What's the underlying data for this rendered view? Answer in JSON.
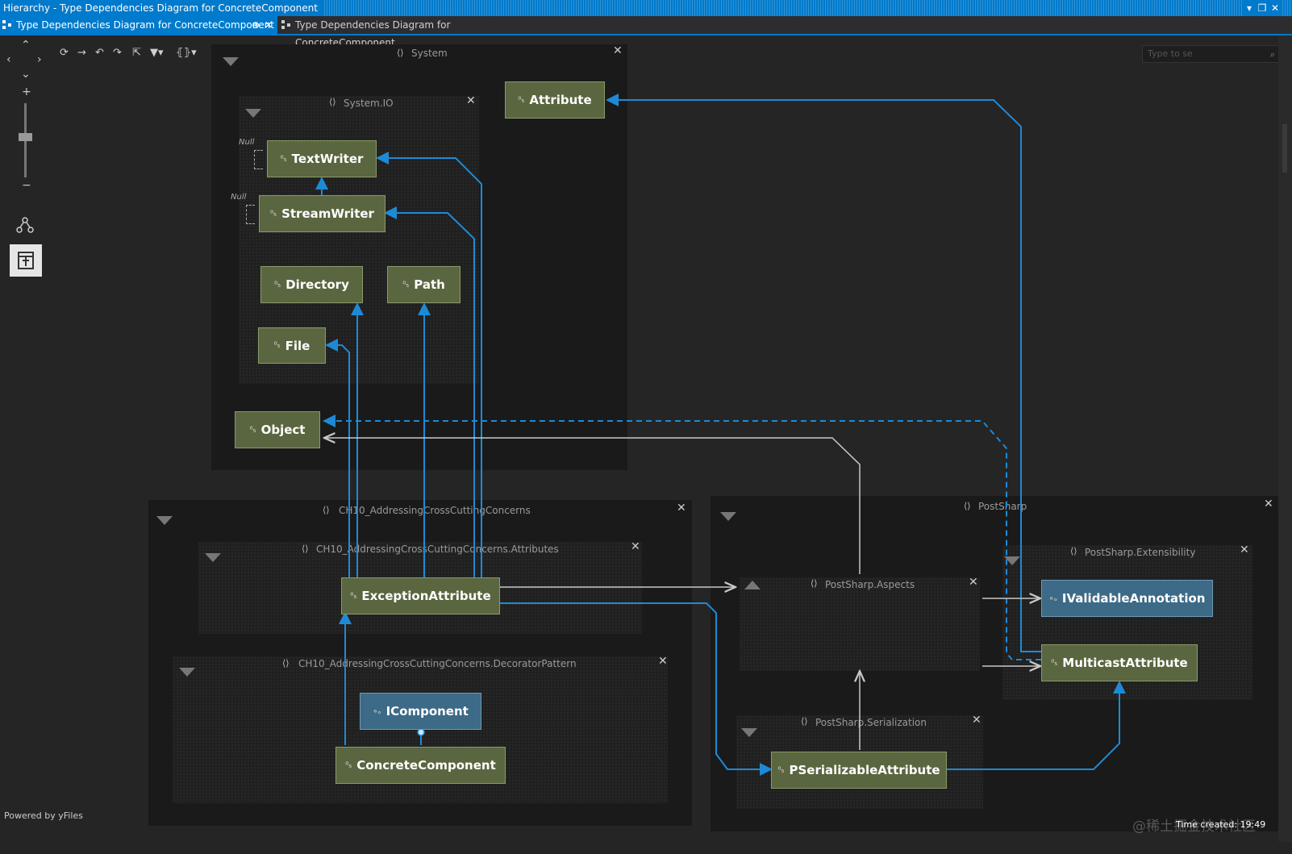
{
  "window": {
    "title": "Hierarchy - Type Dependencies Diagram for ConcreteComponent"
  },
  "tabs": [
    {
      "label": "Type Dependencies Diagram for ConcreteComponent",
      "pin": "⊕",
      "close": "✕"
    },
    {
      "label": "Type Dependencies Diagram for ConcreteComponent"
    }
  ],
  "search": {
    "placeholder": "Type to se"
  },
  "groups": {
    "system": {
      "label": "System"
    },
    "system_io": {
      "label": "System.IO"
    },
    "ch10": {
      "label": "CH10_AddressingCrossCuttingConcerns"
    },
    "ch10_attributes": {
      "label": "CH10_AddressingCrossCuttingConcerns.Attributes"
    },
    "ch10_decorator": {
      "label": "CH10_AddressingCrossCuttingConcerns.DecoratorPattern"
    },
    "postsharp": {
      "label": "PostSharp"
    },
    "postsharp_extensibility": {
      "label": "PostSharp.Extensibility"
    },
    "postsharp_aspects": {
      "label": "PostSharp.Aspects"
    },
    "postsharp_serialization": {
      "label": "PostSharp.Serialization"
    }
  },
  "nodes": {
    "attribute": "Attribute",
    "textwriter": "TextWriter",
    "streamwriter": "StreamWriter",
    "directory": "Directory",
    "path": "Path",
    "file": "File",
    "object": "Object",
    "exceptionattribute": "ExceptionAttribute",
    "icomponent": "IComponent",
    "concretecomponent": "ConcreteComponent",
    "ivalidableannotation": "IValidableAnnotation",
    "multicastattribute": "MulticastAttribute",
    "pserializableattribute": "PSerializableAttribute"
  },
  "null_label": "Null",
  "footer": {
    "powered_by": "Powered by yFiles",
    "time_created": "Time created: 19:49",
    "watermark": "@稀土掘金技术社区"
  },
  "colors": {
    "class_node": "#5a6640",
    "interface_node": "#3d6a86",
    "edge_blue": "#1e8ad6",
    "edge_gray": "#c8c8c8",
    "accent": "#007acc"
  }
}
